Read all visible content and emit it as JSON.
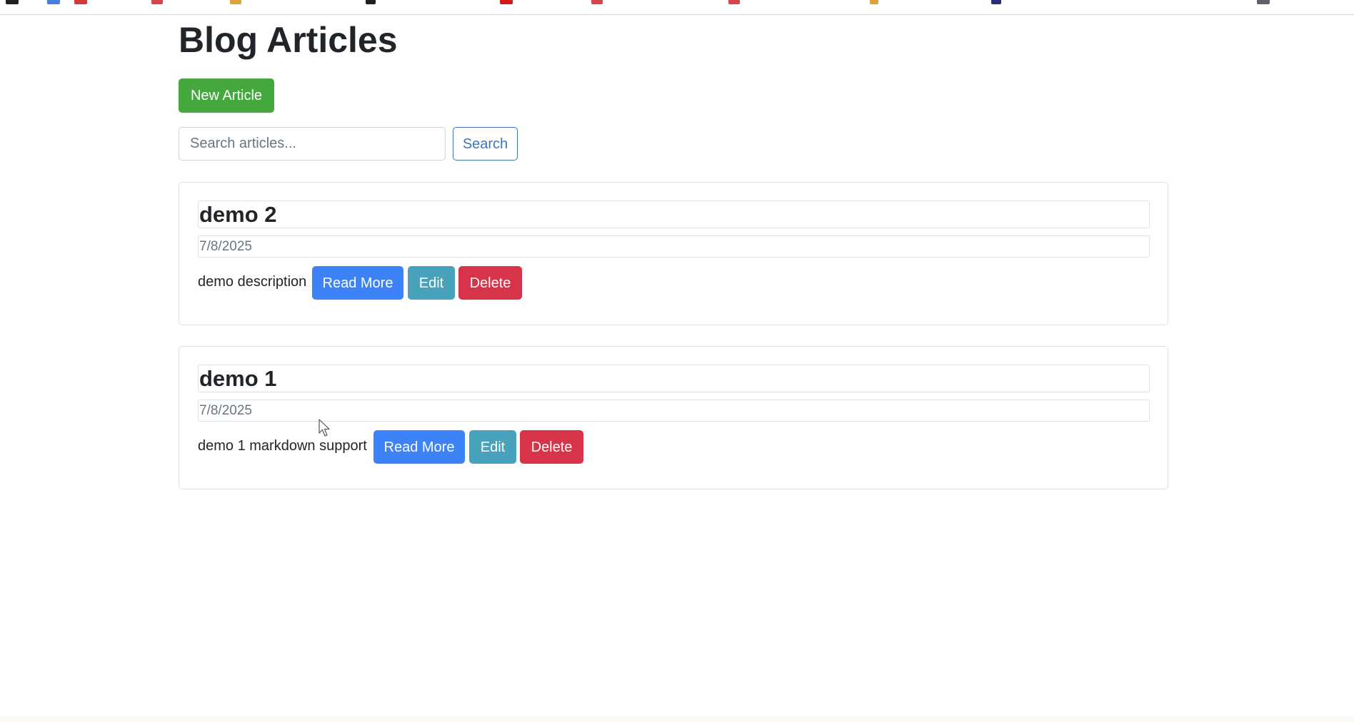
{
  "page": {
    "title": "Blog Articles",
    "new_article_label": "New Article"
  },
  "search": {
    "placeholder": "Search articles...",
    "value": "",
    "button_label": "Search"
  },
  "articles": [
    {
      "title": "demo 2",
      "date": "7/8/2025",
      "description": "demo description",
      "read_more_label": "Read More",
      "edit_label": "Edit",
      "delete_label": "Delete"
    },
    {
      "title": "demo 1",
      "date": "7/8/2025",
      "description": "demo 1 markdown support",
      "read_more_label": "Read More",
      "edit_label": "Edit",
      "delete_label": "Delete"
    }
  ],
  "colors": {
    "success": "#44a83f",
    "primary": "#3d82f7",
    "info": "#48a2bb",
    "danger": "#d7344a",
    "outline": "#3f76b8"
  },
  "icons": {
    "cursor": "mouse-pointer-icon"
  }
}
